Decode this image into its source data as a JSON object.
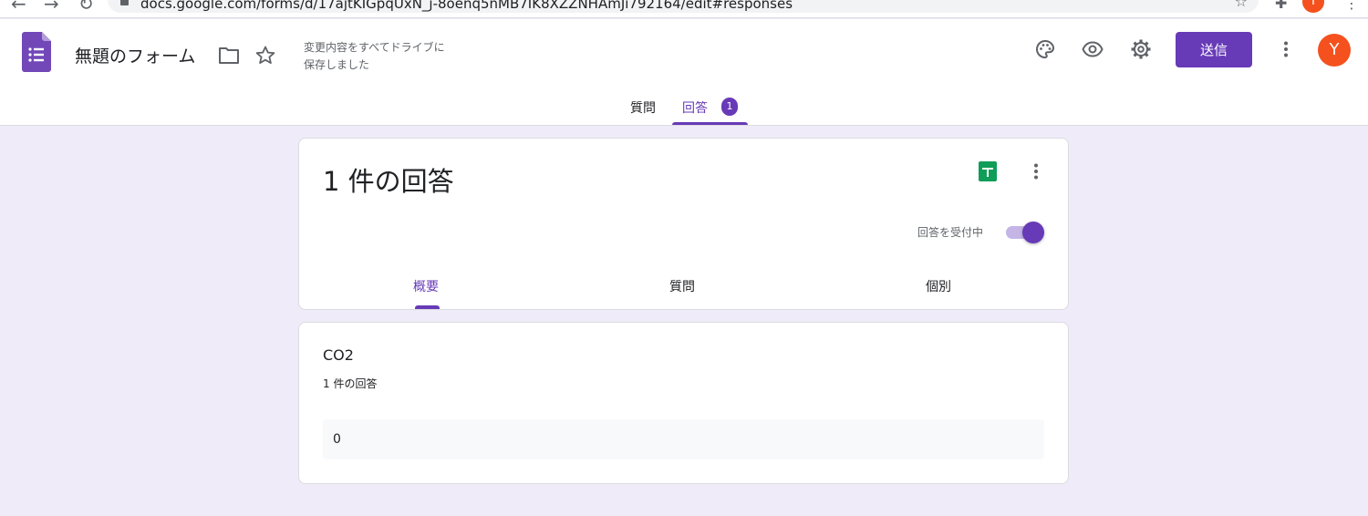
{
  "browser": {
    "url": "docs.google.com/forms/d/17ajtKIGpqUxN_j-8oenq5nMB7IK8XZZNHAmJi792164/edit#responses",
    "avatar_letter": "Y"
  },
  "header": {
    "form_title": "無題のフォーム",
    "save_status_line1": "変更内容をすべてドライブに",
    "save_status_line2": "保存しました",
    "send_label": "送信",
    "avatar_letter": "Y"
  },
  "tabs": {
    "questions": "質問",
    "responses": "回答",
    "responses_badge": "1"
  },
  "summary_card": {
    "title": "1 件の回答",
    "accepting_label": "回答を受付中",
    "accepting_on": true,
    "subtabs": {
      "summary": "概要",
      "question": "質問",
      "individual": "個別"
    }
  },
  "question_card": {
    "title": "CO2",
    "count": "1 件の回答",
    "answer": "0"
  },
  "colors": {
    "accent": "#673ab7",
    "background": "#efebf8",
    "avatar": "#f4511e",
    "sheets_green": "#0f9d58"
  }
}
